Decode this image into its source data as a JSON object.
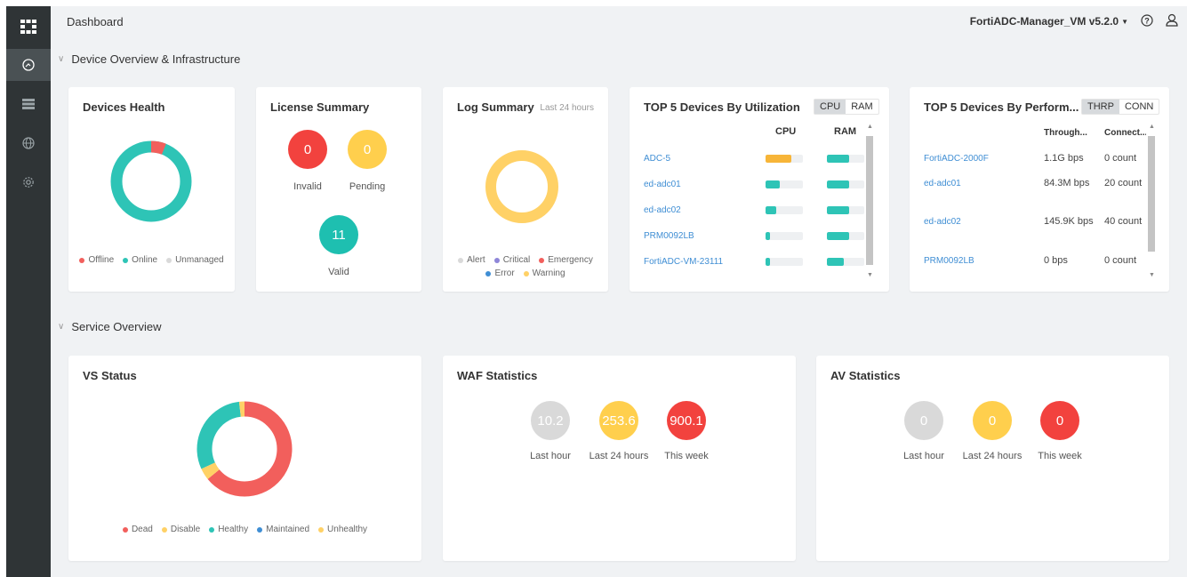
{
  "header": {
    "title": "Dashboard",
    "vm_selector": "FortiADC-Manager_VM v5.2.0"
  },
  "sections": {
    "device_overview": "Device Overview & Infrastructure",
    "service_overview": "Service Overview"
  },
  "devices_health": {
    "title": "Devices Health",
    "legend": [
      "Offline",
      "Online",
      "Unmanaged"
    ],
    "colors": {
      "offline": "#f25f5c",
      "online": "#2ec4b6",
      "unmanaged": "#d9d9d9"
    },
    "offline_fraction": 0.06
  },
  "license_summary": {
    "title": "License Summary",
    "invalid": {
      "value": "0",
      "label": "Invalid"
    },
    "pending": {
      "value": "0",
      "label": "Pending"
    },
    "valid": {
      "value": "11",
      "label": "Valid"
    }
  },
  "log_summary": {
    "title": "Log Summary",
    "subtitle": "Last 24 hours",
    "legend": [
      "Alert",
      "Critical",
      "Emergency",
      "Error",
      "Warning"
    ]
  },
  "top_util": {
    "title": "TOP 5 Devices By Utilization",
    "toggle": [
      "CPU",
      "RAM"
    ],
    "columns": [
      "CPU",
      "RAM"
    ],
    "rows": [
      {
        "name": "ADC-5",
        "cpu": 0.7,
        "ram": 0.6
      },
      {
        "name": "ed-adc01",
        "cpu": 0.38,
        "ram": 0.6
      },
      {
        "name": "ed-adc02",
        "cpu": 0.28,
        "ram": 0.6
      },
      {
        "name": "PRM0092LB",
        "cpu": 0.12,
        "ram": 0.6
      },
      {
        "name": "FortiADC-VM-23111",
        "cpu": 0.12,
        "ram": 0.45
      }
    ]
  },
  "top_perf": {
    "title": "TOP 5 Devices By Perform...",
    "toggle": [
      "THRP",
      "CONN"
    ],
    "columns": [
      "Through...",
      "Connect..."
    ],
    "rows": [
      {
        "name": "FortiADC-2000F",
        "thrp": "1.1G bps",
        "conn": "0 count"
      },
      {
        "name": "ed-adc01",
        "thrp": "84.3M bps",
        "conn": "20 count"
      },
      {
        "name": "ed-adc02",
        "thrp": "145.9K bps",
        "conn": "40 count"
      },
      {
        "name": "PRM0092LB",
        "thrp": "0 bps",
        "conn": "0 count"
      }
    ]
  },
  "vs_status": {
    "title": "VS Status",
    "legend": [
      "Dead",
      "Disable",
      "Healthy",
      "Maintained",
      "Unhealthy"
    ],
    "fractions": {
      "dead": 0.64,
      "disable": 0.04,
      "healthy": 0.3,
      "unhealthy": 0.02
    }
  },
  "waf": {
    "title": "WAF Statistics",
    "items": [
      {
        "value": "10.2",
        "label": "Last hour"
      },
      {
        "value": "253.6",
        "label": "Last 24 hours"
      },
      {
        "value": "900.1",
        "label": "This week"
      }
    ]
  },
  "av": {
    "title": "AV Statistics",
    "items": [
      {
        "value": "0",
        "label": "Last hour"
      },
      {
        "value": "0",
        "label": "Last 24 hours"
      },
      {
        "value": "0",
        "label": "This week"
      }
    ]
  },
  "colors": {
    "red": "#f25f5c",
    "yellow": "#ffd166",
    "orange": "#f7b538",
    "teal": "#2ec4b6",
    "gray": "#d9d9d9",
    "blue": "#3f8ed4",
    "purple": "#8e86d8"
  }
}
